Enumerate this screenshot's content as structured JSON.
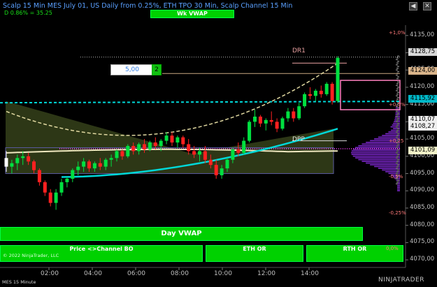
{
  "window": {
    "title": "Scalp 15 Min MES July 01, US Daily from 0.25%, ETH TPO 30 Min, Scalp Channel 15 Min",
    "subtitle": "D 0.86% = 35.25",
    "scroll_button": "◀",
    "close_button": "✕"
  },
  "order_controls": {
    "quantity": "5,00",
    "multiplier": "2"
  },
  "indicator_buttons": {
    "wk_vwap": "Wk VWAP",
    "day_vwap": "Day VWAP",
    "price_channel": "Price <>Channel BO",
    "eth_or": "ETH OR",
    "rth_or": "RTH OR"
  },
  "copyright": "© 2022 NinjaTrader, LLC",
  "chart_labels": {
    "dr1": "DR1",
    "dpp": "DPP"
  },
  "price_axis": {
    "labels": [
      "4135,00",
      "4130,00",
      "4125,00",
      "4120,00",
      "4115,00",
      "4110,00",
      "4105,00",
      "4100,00",
      "4095,00",
      "4090,00",
      "4085,00",
      "4080,00",
      "4075,00",
      "4070,00"
    ],
    "markers": [
      {
        "text": "4128,75",
        "bg": "#d8d8d8",
        "fg": "#000000"
      },
      {
        "text": "4124,00",
        "bg": "#d9b48a",
        "fg": "#000000"
      },
      {
        "text": "4115,92",
        "bg": "#00b8c8",
        "fg": "#000000"
      },
      {
        "text": "4110,07",
        "bg": "#eeeeee",
        "fg": "#000000"
      },
      {
        "text": "4108,27",
        "bg": "#eeeeee",
        "fg": "#000000"
      },
      {
        "text": "4101,09",
        "bg": "#f2f2c8",
        "fg": "#000000"
      }
    ],
    "percent_labels": [
      {
        "text": "+1,0%",
        "color": "#ff7a7a"
      },
      {
        "text": "+0,5%",
        "color": "#ff7a7a"
      },
      {
        "text": "+0,25",
        "color": "#ff7a7a"
      },
      {
        "text": "-0,25%",
        "color": "#ff7a7a"
      },
      {
        "text": "-0,5%",
        "color": "#ff7a7a"
      },
      {
        "text": "0,0%",
        "color": "#ff7a7a"
      }
    ]
  },
  "time_axis": {
    "labels": [
      "02:00",
      "04:00",
      "06:00",
      "08:00",
      "10:00",
      "12:00",
      "14:00"
    ]
  },
  "footer": {
    "instrument": "MES 15 Minute",
    "brand": "NINJATRADER"
  },
  "colors": {
    "up": "#00e040",
    "down": "#ff2020",
    "vwap": "#00d8d8",
    "wk_vwap": "#f0e8c0",
    "dpp": "#e0d8a0",
    "profile": "#8a2be2"
  },
  "chart_data": {
    "type": "candlestick",
    "x": [
      "00:00",
      "00:15",
      "00:30",
      "00:45",
      "01:00",
      "01:15",
      "01:30",
      "01:45",
      "02:00",
      "02:15",
      "02:30",
      "02:45",
      "03:00",
      "03:15",
      "03:30",
      "03:45",
      "04:00",
      "04:15",
      "04:30",
      "04:45",
      "05:00",
      "05:15",
      "05:30",
      "05:45",
      "06:00",
      "06:15",
      "06:30",
      "06:45",
      "07:00",
      "07:15",
      "07:30",
      "07:45",
      "08:00",
      "08:15",
      "08:30",
      "08:45",
      "09:00",
      "09:15",
      "09:30",
      "09:45",
      "10:00",
      "10:15",
      "10:30",
      "10:45",
      "11:00",
      "11:15",
      "11:30",
      "11:45",
      "12:00",
      "12:15",
      "12:30",
      "12:45",
      "13:00",
      "13:15",
      "13:30",
      "13:45",
      "14:00",
      "14:15",
      "14:30",
      "14:45",
      "15:00",
      "15:15"
    ],
    "ohlc": [
      [
        4099.5,
        4101.5,
        4095.5,
        4097
      ],
      [
        4097,
        4099,
        4095,
        4098
      ],
      [
        4098,
        4100.5,
        4096,
        4099.5
      ],
      [
        4099.5,
        4101.5,
        4097.5,
        4100
      ],
      [
        4100,
        4101,
        4097.5,
        4098.5
      ],
      [
        4098.5,
        4099,
        4095,
        4096
      ],
      [
        4096,
        4096.5,
        4091.5,
        4092.5
      ],
      [
        4092.5,
        4093,
        4088.5,
        4089.5
      ],
      [
        4089.5,
        4090.5,
        4085.5,
        4086.5
      ],
      [
        4086.5,
        4090.5,
        4084.5,
        4089.5
      ],
      [
        4089.5,
        4093.5,
        4088.5,
        4092.5
      ],
      [
        4092.5,
        4094,
        4091,
        4093.5
      ],
      [
        4093.5,
        4096.5,
        4092.5,
        4096
      ],
      [
        4096,
        4098.5,
        4094.5,
        4097
      ],
      [
        4097,
        4099.5,
        4095.5,
        4098.5
      ],
      [
        4098.5,
        4099,
        4095.5,
        4096.5
      ],
      [
        4096.5,
        4098.5,
        4095.5,
        4098
      ],
      [
        4098,
        4099.5,
        4096,
        4097
      ],
      [
        4097,
        4099.5,
        4096,
        4099
      ],
      [
        4099,
        4100.5,
        4097,
        4099.5
      ],
      [
        4099.5,
        4102,
        4098.5,
        4101.5
      ],
      [
        4101.5,
        4102,
        4099,
        4100
      ],
      [
        4100,
        4103.5,
        4099.5,
        4103
      ],
      [
        4103,
        4104,
        4100.5,
        4101.5
      ],
      [
        4101.5,
        4104,
        4100.5,
        4103.5
      ],
      [
        4103.5,
        4105,
        4101,
        4102
      ],
      [
        4102,
        4104.5,
        4101.5,
        4104
      ],
      [
        4104,
        4105.5,
        4102,
        4103
      ],
      [
        4103,
        4105,
        4101.5,
        4104.5
      ],
      [
        4104.5,
        4107,
        4103.5,
        4106
      ],
      [
        4106,
        4107,
        4103,
        4104
      ],
      [
        4104,
        4106,
        4102.5,
        4105.5
      ],
      [
        4105.5,
        4106,
        4102.5,
        4103.5
      ],
      [
        4103.5,
        4105,
        4100.5,
        4101.5
      ],
      [
        4101.5,
        4103,
        4099.5,
        4100.5
      ],
      [
        4100.5,
        4102.5,
        4098.5,
        4101.5
      ],
      [
        4101.5,
        4103,
        4098,
        4099
      ],
      [
        4099,
        4100.5,
        4096.5,
        4097.5
      ],
      [
        4097.5,
        4099,
        4093.5,
        4094.5
      ],
      [
        4094.5,
        4097.5,
        4093.5,
        4096.5
      ],
      [
        4096.5,
        4099.5,
        4095.5,
        4099
      ],
      [
        4099,
        4102.5,
        4098,
        4102
      ],
      [
        4102,
        4104,
        4100,
        4101
      ],
      [
        4101,
        4105.5,
        4100.5,
        4104.5
      ],
      [
        4104.5,
        4110.5,
        4104,
        4110
      ],
      [
        4110,
        4113.5,
        4108.5,
        4111.5
      ],
      [
        4111.5,
        4112,
        4108.5,
        4109.5
      ],
      [
        4109.5,
        4111,
        4107.5,
        4110.5
      ],
      [
        4110.5,
        4113,
        4109,
        4110
      ],
      [
        4110,
        4111,
        4107,
        4108
      ],
      [
        4108,
        4111.5,
        4107.5,
        4111
      ],
      [
        4111,
        4114,
        4110,
        4113
      ],
      [
        4113,
        4114,
        4110,
        4111
      ],
      [
        4111,
        4115.5,
        4110.5,
        4114.5
      ],
      [
        4114.5,
        4118.5,
        4114,
        4118
      ],
      [
        4118,
        4120,
        4116.5,
        4117.5
      ],
      [
        4117.5,
        4119.5,
        4116,
        4119
      ],
      [
        4119,
        4120.5,
        4117,
        4118
      ],
      [
        4118,
        4121.5,
        4117.5,
        4121
      ],
      [
        4121,
        4121.5,
        4115,
        4116
      ],
      [
        4116,
        4129,
        4115.5,
        4128.5
      ]
    ],
    "levels": {
      "DR1": 4128.75,
      "DPP": 4106.27,
      "last": 4128.75,
      "wk_vwap": 4101.09,
      "day_vwap": 4115.92,
      "order_price": 4124.0
    },
    "y_range": [
      4068,
      4138
    ]
  }
}
